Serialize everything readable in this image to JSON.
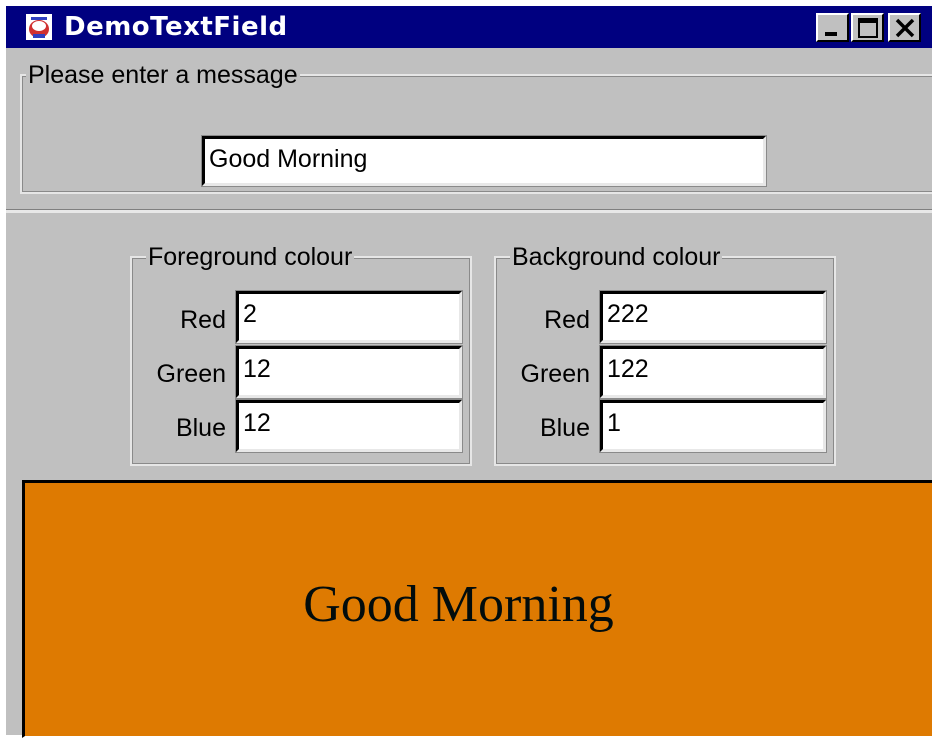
{
  "window": {
    "title": "DemoTextField"
  },
  "title_buttons": {
    "minimize": "_",
    "maximize": "□",
    "close": "X"
  },
  "message": {
    "group_label": "Please enter a message",
    "value": "Good Morning"
  },
  "foreground": {
    "group_label": "Foreground colour",
    "red_label": "Red",
    "red_value": "2",
    "green_label": "Green",
    "green_value": "12",
    "blue_label": "Blue",
    "blue_value": "12"
  },
  "background": {
    "group_label": "Background colour",
    "red_label": "Red",
    "red_value": "222",
    "green_label": "Green",
    "green_value": "122",
    "blue_label": "Blue",
    "blue_value": "1"
  },
  "preview": {
    "text": "Good Morning",
    "background_color": "#de7a01",
    "text_color": "#020c0c"
  },
  "colors": {
    "titlebar": "#000080",
    "window_face": "#c0c0c0"
  },
  "icons": [
    "app-icon",
    "minimize-icon",
    "maximize-icon",
    "close-icon"
  ]
}
